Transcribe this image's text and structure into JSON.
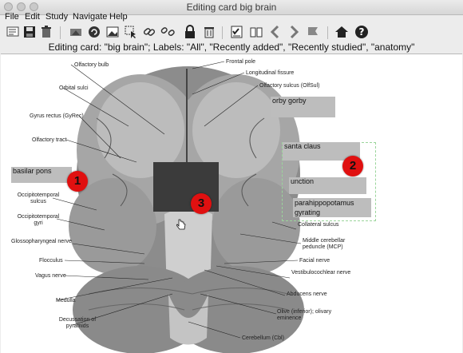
{
  "window": {
    "title": "Editing card big brain"
  },
  "menu": [
    "File",
    "Edit",
    "Study",
    "Navigate",
    "Help"
  ],
  "toolbar": {
    "icons": [
      "new-card-icon",
      "save-icon",
      "trash-icon",
      "fill-icon",
      "rotate-icon",
      "image-icon",
      "select-cursor-icon",
      "link-icon",
      "unlink-icon",
      "lock-icon",
      "trash-can-icon",
      "checklist-icon",
      "book-icon",
      "back-arrow-icon",
      "forward-arrow-icon",
      "flag-icon",
      "home-icon",
      "help-icon"
    ]
  },
  "status_line": "Editing card: \"big brain\"; Labels: \"All\", \"Recently added\", \"Recently studied\", \"anatomy\"",
  "image_labels": {
    "left": [
      "Olfactory bulb",
      "Orbital sulci",
      "Gyrus rectus (GyRec)",
      "Olfactory tract",
      "Occipitotemporal sulcus",
      "Occipitotemporal gyri",
      "Glossopharyngeal nerve",
      "Flocculus",
      "Vagus nerve",
      "Medulla",
      "Decussation of pyramids"
    ],
    "right": [
      "Frontal pole",
      "Longitudinal fissure",
      "Olfactory sulcus (OlfSul)",
      "Collateral sulcus",
      "Middle cerebellar peduncle (MCP)",
      "Facial nerve",
      "Vestibulocochlear nerve",
      "Abducens nerve",
      "Olive (inferior); olivary eminence",
      "Cerebellum (Cbl)"
    ]
  },
  "occlusions": {
    "basilar": "basilar pons",
    "orby": "orby gorby",
    "santa": "santa claus",
    "junction": "unction",
    "hippo": "parahippopotamus",
    "gyrating": "gyrating"
  },
  "markers": [
    "1",
    "2",
    "3"
  ]
}
